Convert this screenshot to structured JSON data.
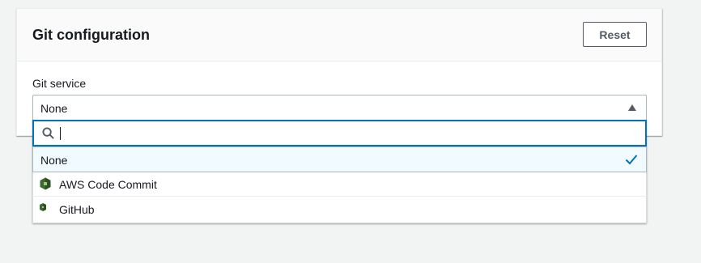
{
  "panel": {
    "title": "Git configuration",
    "reset_label": "Reset"
  },
  "field": {
    "label": "Git service",
    "selected_value": "None"
  },
  "search": {
    "value": ""
  },
  "options": [
    {
      "label": "None",
      "selected": true
    },
    {
      "label": "AWS Code Commit",
      "icon": "codecommit-icon"
    },
    {
      "label": "GitHub",
      "icon": "github-icon"
    }
  ],
  "colors": {
    "focus": "#0073bb",
    "check": "#0073bb",
    "selected_bg": "#f1faff",
    "icon_green": "#3b6b2f"
  }
}
